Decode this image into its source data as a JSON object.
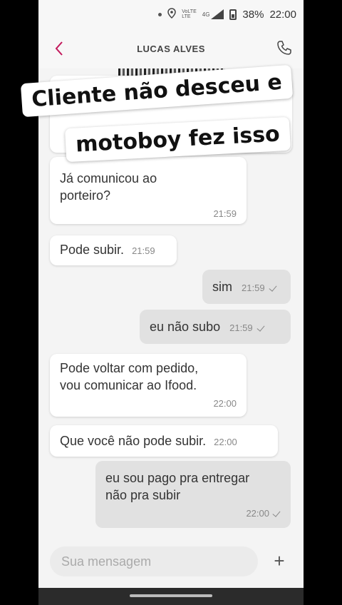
{
  "status_bar": {
    "network_top": "VoLTE",
    "network_bottom": "LTE",
    "network_type": "4G",
    "battery": "38%",
    "time": "22:00"
  },
  "header": {
    "title": "LUCAS ALVES",
    "accent_color": "#c2185b"
  },
  "caption": {
    "line1": "Cliente não desceu e",
    "line2": "motoboy fez isso"
  },
  "messages": [
    {
      "direction": "in",
      "text": "Já comunicou ao porteiro?",
      "visible_text_top": "Já comunicou ao",
      "visible_text_bottom": "porteiro?",
      "time": "21:59"
    },
    {
      "direction": "in",
      "text": "Pode subir.",
      "time": "21:59"
    },
    {
      "direction": "out",
      "text": "sim",
      "time": "21:59",
      "status": "sent"
    },
    {
      "direction": "out",
      "text": "eu não subo",
      "time": "21:59",
      "status": "sent"
    },
    {
      "direction": "in",
      "line1": "Pode voltar com pedido,",
      "line2": "vou comunicar ao Ifood.",
      "time": "22:00"
    },
    {
      "direction": "in",
      "text": "Que você não pode subir.",
      "time": "22:00"
    },
    {
      "direction": "out",
      "line1": "eu sou pago pra entregar",
      "line2": "não pra subir",
      "time": "22:00",
      "status": "sent"
    }
  ],
  "composer": {
    "placeholder": "Sua mensagem",
    "add_label": "+"
  }
}
